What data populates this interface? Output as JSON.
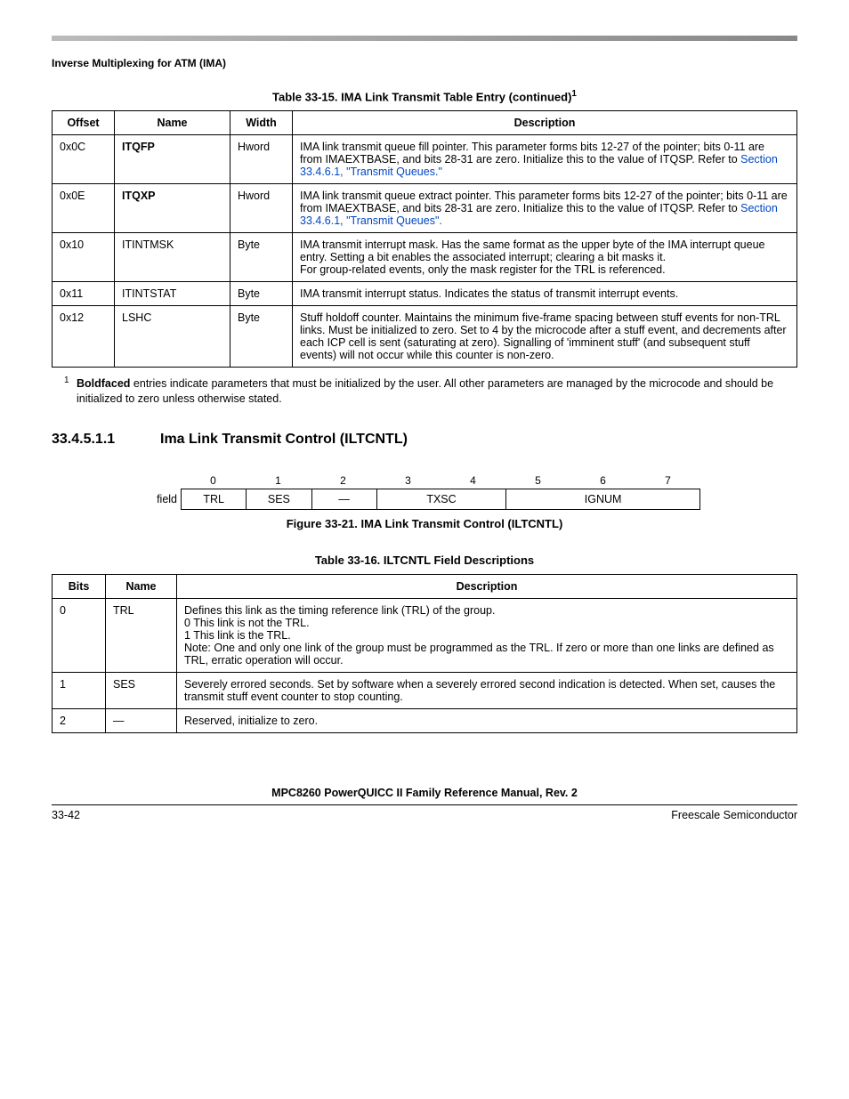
{
  "header": {
    "section_label": "Inverse Multiplexing for ATM (IMA)"
  },
  "table15": {
    "title_prefix": "Table 33-15. IMA Link Transmit Table Entry (continued)",
    "headers": {
      "offset": "Offset",
      "name": "Name",
      "width": "Width",
      "description": "Description"
    },
    "rows": [
      {
        "offset": "0x0C",
        "name": "ITQFP",
        "name_bold": true,
        "width": "Hword",
        "desc_pre": "IMA link transmit queue fill pointer. This parameter forms bits 12-27 of the pointer; bits 0-11 are from IMAEXTBASE, and bits 28-31 are zero. Initialize this to the value of ITQSP. Refer to ",
        "desc_link": "Section 33.4.6.1, \"Transmit Queues.\"",
        "desc_post": ""
      },
      {
        "offset": "0x0E",
        "name": "ITQXP",
        "name_bold": true,
        "width": "Hword",
        "desc_pre": "IMA link transmit queue extract pointer. This parameter forms bits 12-27 of the pointer; bits 0-11 are from IMAEXTBASE, and bits 28-31 are zero. Initialize this to the value of ITQSP. Refer to ",
        "desc_link": "Section 33.4.6.1, \"Transmit Queues\".",
        "desc_post": ""
      },
      {
        "offset": "0x10",
        "name": "ITINTMSK",
        "name_bold": false,
        "width": "Byte",
        "desc_pre": "IMA transmit interrupt mask. Has the same format as the upper byte of the IMA interrupt queue entry. Setting a bit enables the associated interrupt; clearing a bit masks it.\nFor group-related events, only the mask register for the TRL is referenced.",
        "desc_link": "",
        "desc_post": ""
      },
      {
        "offset": "0x11",
        "name": "ITINTSTAT",
        "name_bold": false,
        "width": "Byte",
        "desc_pre": "IMA transmit interrupt status. Indicates the status of transmit interrupt events.",
        "desc_link": "",
        "desc_post": ""
      },
      {
        "offset": "0x12",
        "name": "LSHC",
        "name_bold": false,
        "width": "Byte",
        "desc_pre": "Stuff holdoff counter. Maintains the minimum five-frame spacing between stuff events for non-TRL links. Must be initialized to zero. Set to 4 by the microcode after a stuff event, and decrements after each ICP cell is sent (saturating at zero). Signalling of 'imminent stuff' (and subsequent stuff events) will not occur while this counter is non-zero.",
        "desc_link": "",
        "desc_post": ""
      }
    ]
  },
  "footnote": {
    "marker": "1",
    "bold_lead": "Boldfaced",
    "text_rest": " entries indicate parameters that must be initialized by the user. All other parameters are managed by the microcode and should be initialized to zero unless otherwise stated."
  },
  "section": {
    "number": "33.4.5.1.1",
    "title": "Ima Link Transmit Control (ILTCNTL)"
  },
  "bitfig": {
    "nums": [
      "0",
      "1",
      "2",
      "3",
      "4",
      "5",
      "6",
      "7"
    ],
    "row_label": "field",
    "fields": [
      {
        "label": "TRL",
        "span": 1
      },
      {
        "label": "SES",
        "span": 1
      },
      {
        "label": "—",
        "span": 1
      },
      {
        "label": "TXSC",
        "span": 2
      },
      {
        "label": "IGNUM",
        "span": 3
      }
    ],
    "caption": "Figure 33-21. IMA Link Transmit Control (ILTCNTL)"
  },
  "table16": {
    "title": "Table 33-16. ILTCNTL Field Descriptions",
    "headers": {
      "bits": "Bits",
      "name": "Name",
      "description": "Description"
    },
    "rows": [
      {
        "bits": "0",
        "name": "TRL",
        "desc_lines": [
          "Defines this link as the timing reference link (TRL) of the group.",
          "0   This link is not the TRL.",
          "1   This link is the TRL.",
          "Note: One and only one link of the group must be programmed as the TRL. If zero or more than one links are defined as TRL, erratic operation will occur."
        ]
      },
      {
        "bits": "1",
        "name": "SES",
        "desc_lines": [
          "Severely errored seconds. Set by software when a severely errored second indication is detected. When set, causes the transmit stuff event counter to stop counting."
        ]
      },
      {
        "bits": "2",
        "name": "—",
        "desc_lines": [
          "Reserved, initialize to zero."
        ]
      }
    ]
  },
  "footer": {
    "doc_title": "MPC8260 PowerQUICC II Family Reference Manual, Rev. 2",
    "page": "33-42",
    "vendor": "Freescale Semiconductor"
  }
}
